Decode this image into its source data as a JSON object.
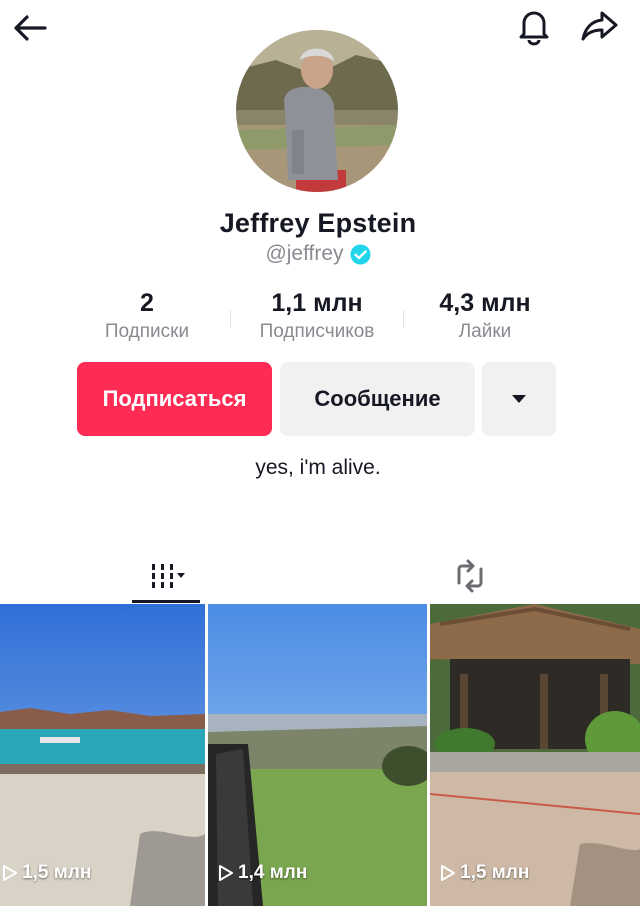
{
  "profile": {
    "name": "Jeffrey Epstein",
    "handle": "@jeffrey",
    "verified": true,
    "bio": "yes, i'm alive."
  },
  "stats": [
    {
      "value": "2",
      "label": "Подписки"
    },
    {
      "value": "1,1 млн",
      "label": "Подписчиков"
    },
    {
      "value": "4,3 млн",
      "label": "Лайки"
    }
  ],
  "buttons": {
    "follow": "Подписаться",
    "message": "Сообщение"
  },
  "videos": [
    {
      "views": "1,5 млн"
    },
    {
      "views": "1,4 млн"
    },
    {
      "views": "1,5 млн"
    }
  ],
  "colors": {
    "accent": "#fe2c55",
    "verified": "#20d5ec",
    "secondary_text": "#8a8b91"
  },
  "icons": [
    "back-arrow-icon",
    "bell-icon",
    "share-icon",
    "verified-icon",
    "dropdown-triangle-icon",
    "videos-grid-icon",
    "repost-icon",
    "play-icon"
  ]
}
